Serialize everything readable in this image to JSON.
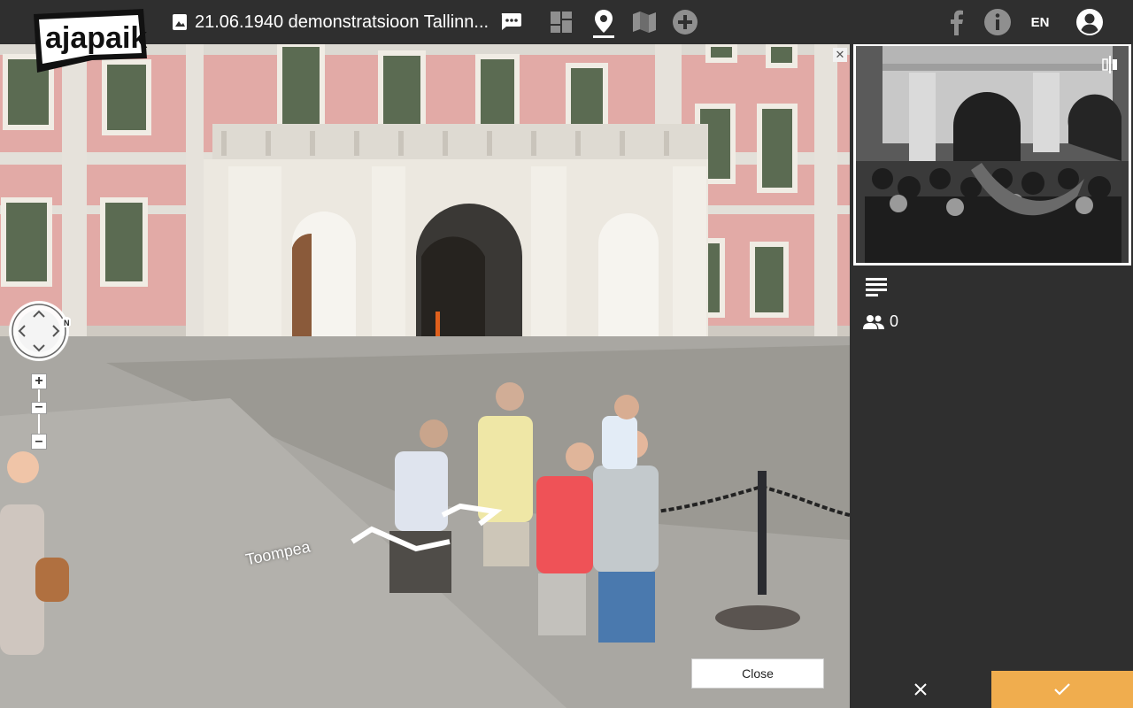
{
  "app": {
    "logo_text": "ajapaik"
  },
  "header": {
    "photo_title": "21.06.1940 demonstratsioon Tallinn...",
    "language": "EN",
    "icons": [
      "image-icon",
      "comment-icon",
      "dashboard-icon",
      "location-pin-icon",
      "map-icon",
      "add-icon",
      "facebook-icon",
      "info-icon",
      "account-icon"
    ]
  },
  "streetview": {
    "road_label": "Toompea",
    "close_label": "Close",
    "compass_label": "N"
  },
  "panel": {
    "rephoto_count": "0"
  },
  "colors": {
    "bar": "#2f2f2f",
    "accent": "#f0ad4e"
  }
}
